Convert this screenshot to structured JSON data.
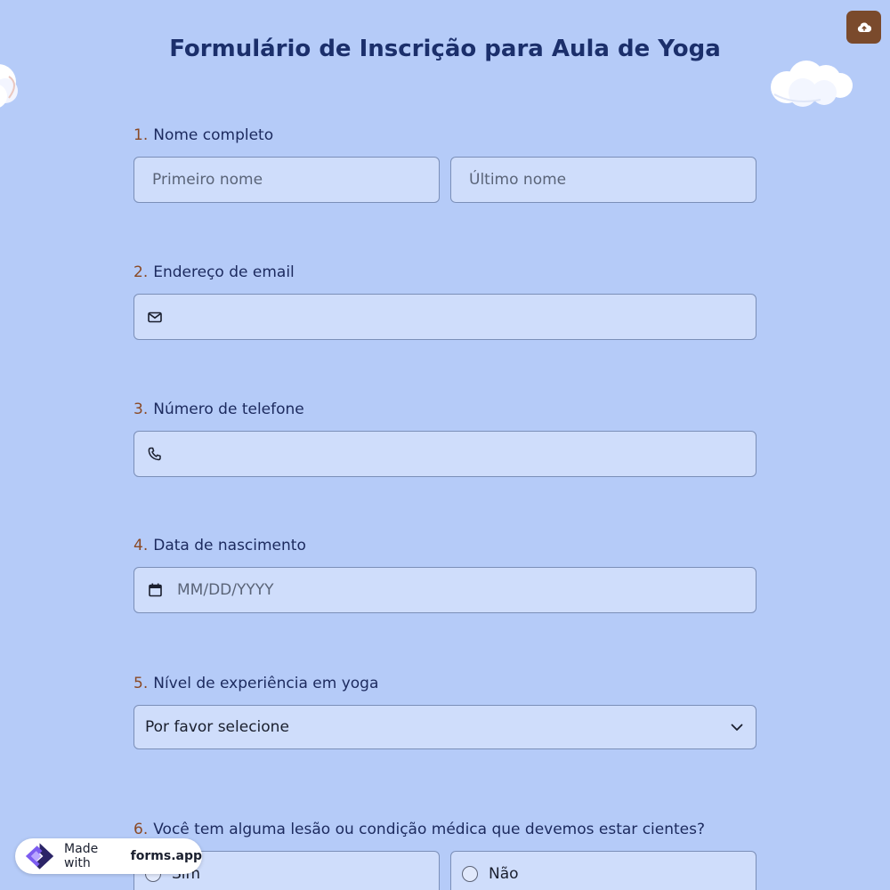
{
  "form": {
    "title": "Formulário de Inscrição para Aula de Yoga"
  },
  "questions": [
    {
      "number": "1.",
      "label": "Nome completo",
      "first_placeholder": "Primeiro nome",
      "last_placeholder": "Último nome"
    },
    {
      "number": "2.",
      "label": "Endereço de email",
      "icon": "mail-icon"
    },
    {
      "number": "3.",
      "label": "Número de telefone",
      "icon": "phone-icon"
    },
    {
      "number": "4.",
      "label": "Data de nascimento",
      "icon": "calendar-icon",
      "placeholder": "MM/DD/YYYY"
    },
    {
      "number": "5.",
      "label": "Nível de experiência em yoga",
      "selected": "Por favor selecione"
    },
    {
      "number": "6.",
      "label": "Você tem alguma lesão ou condição médica que devemos estar cientes?",
      "options": [
        "Sim",
        "Não"
      ]
    }
  ],
  "badge": {
    "made_with": "Made with",
    "brand": "forms.app"
  },
  "colors": {
    "background": "#b5cbf8",
    "input_fill": "#cfddfb",
    "accent_brown": "#7a4a2c",
    "title_navy": "#1b2f6b"
  }
}
